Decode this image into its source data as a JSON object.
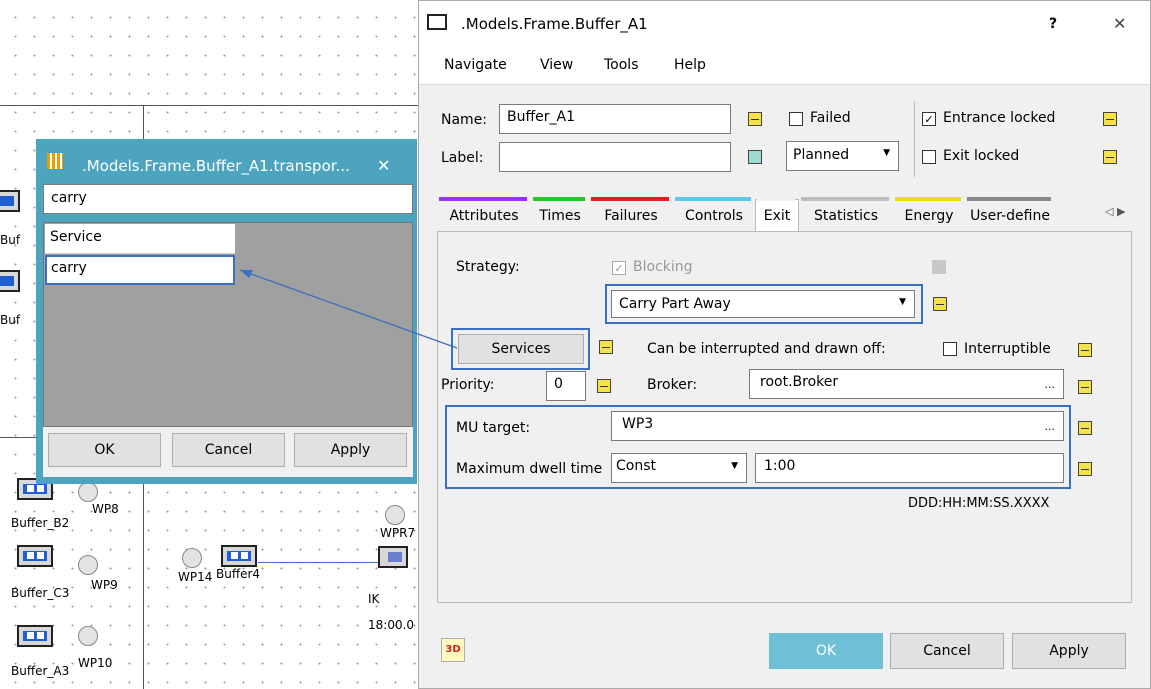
{
  "canvas": {
    "labels": [
      "Buf",
      "Buf",
      "Buffer_B2",
      "WP8",
      "Buffer_C3",
      "WP9",
      "WP14",
      "Buffer4",
      "IK",
      "18:00.0",
      "WPR7",
      "Buffer_A3",
      "WP10"
    ]
  },
  "main_dialog": {
    "title": ".Models.Frame.Buffer_A1",
    "help": "?",
    "close": "✕",
    "menu": [
      "Navigate",
      "View",
      "Tools",
      "Help"
    ],
    "name_label": "Name:",
    "name_value": "Buffer_A1",
    "label_label": "Label:",
    "label_value": "",
    "failed_label": "Failed",
    "planned_value": "Planned",
    "entrance_locked_label": "Entrance locked",
    "entrance_locked_checked": true,
    "exit_locked_label": "Exit locked",
    "tabs": [
      "Attributes",
      "Times",
      "Failures",
      "Controls",
      "Exit",
      "Statistics",
      "Energy",
      "User-define"
    ],
    "tab_colors": [
      "#9b30ff",
      "#22cc22",
      "#e02020",
      "#5ac8f0",
      "#f0f0f0",
      "#bdbdbd",
      "#f0e000",
      "#888888"
    ],
    "active_tab": "Exit",
    "strategy_label": "Strategy:",
    "blocking_label": "Blocking",
    "strategy_value": "Carry Part Away",
    "services_button": "Services",
    "interrupt_text": "Can be interrupted and drawn off:",
    "interruptible_label": "Interruptible",
    "priority_label": "Priority:",
    "priority_value": "0",
    "broker_label": "Broker:",
    "broker_value": "root.Broker",
    "mu_target_label": "MU target:",
    "mu_target_value": "WP3",
    "dwell_label": "Maximum dwell time",
    "dwell_type": "Const",
    "dwell_value": "1:00",
    "time_format": "DDD:HH:MM:SS.XXXX",
    "btn_3d": "3D",
    "ok": "OK",
    "cancel": "Cancel",
    "apply": "Apply",
    "ellipsis": "..."
  },
  "transport_dialog": {
    "title": ".Models.Frame.Buffer_A1.transpor...",
    "close": "✕",
    "input_value": "carry",
    "list": [
      "Service",
      "carry"
    ],
    "ok": "OK",
    "cancel": "Cancel",
    "apply": "Apply"
  }
}
